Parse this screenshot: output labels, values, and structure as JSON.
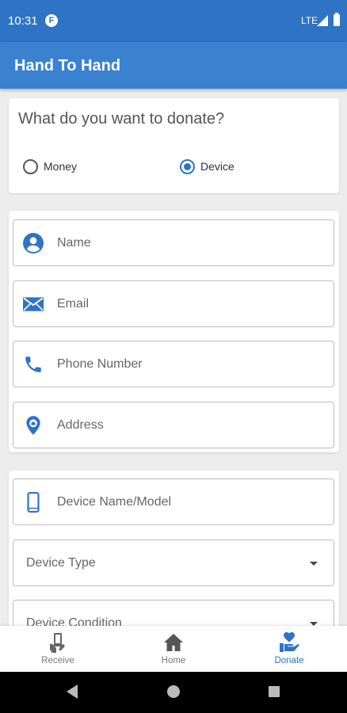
{
  "status_bar": {
    "time": "10:31",
    "carrier_badge": "F",
    "network": "LTE"
  },
  "app_bar": {
    "title": "Hand To Hand"
  },
  "donation_type": {
    "question": "What do you want to donate?",
    "options": [
      {
        "label": "Money",
        "selected": false
      },
      {
        "label": "Device",
        "selected": true
      }
    ]
  },
  "contact_form": {
    "name": {
      "placeholder": "Name",
      "icon": "account-circle-icon"
    },
    "email": {
      "placeholder": "Email",
      "icon": "envelope-icon"
    },
    "phone": {
      "placeholder": "Phone Number",
      "icon": "phone-icon"
    },
    "address": {
      "placeholder": "Address",
      "icon": "location-pin-icon"
    }
  },
  "device_form": {
    "device_name": {
      "placeholder": "Device Name/Model",
      "icon": "smartphone-icon"
    },
    "device_type": {
      "placeholder": "Device Type"
    },
    "device_condition": {
      "placeholder": "Device Condition"
    }
  },
  "bottom_nav": {
    "items": [
      {
        "label": "Receive",
        "icon": "receive-hand-icon",
        "active": false
      },
      {
        "label": "Home",
        "icon": "home-icon",
        "active": false
      },
      {
        "label": "Donate",
        "icon": "donate-heart-hand-icon",
        "active": true
      }
    ]
  },
  "colors": {
    "primary": "#3a82d0",
    "status_bar": "#2f73c4",
    "accent": "#2f73c4",
    "background": "#ececec"
  }
}
